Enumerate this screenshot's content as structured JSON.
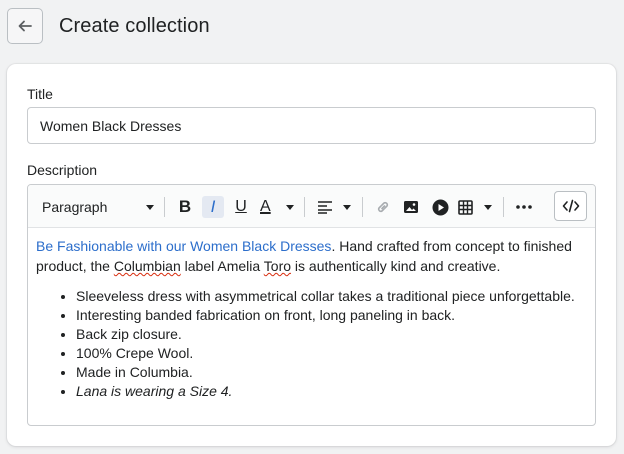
{
  "header": {
    "title": "Create collection",
    "back_icon": "arrow-left-icon"
  },
  "form": {
    "title_label": "Title",
    "title_value": "Women Black Dresses",
    "description_label": "Description"
  },
  "toolbar": {
    "paragraph_label": "Paragraph",
    "bold": "B",
    "italic": "I",
    "underline": "U",
    "text_color": "A",
    "icons": [
      "align-left-icon",
      "link-icon",
      "image-icon",
      "video-icon",
      "table-icon",
      "more-icon",
      "code-icon"
    ]
  },
  "description": {
    "link_text": "Be Fashionable with our Women Black Dresses",
    "p1": ". Hand crafted from concept to finished product, the ",
    "p2": "Columbian",
    "p3": " label Amelia ",
    "p4": "Toro",
    "p5": " is authentically kind and creative.",
    "bullets": [
      "Sleeveless dress with asymmetrical collar takes a traditional piece unforgettable.",
      "Interesting banded fabrication on front, long paneling in back.",
      "Back zip closure.",
      "100% Crepe Wool.",
      "Made in Columbia.",
      "Lana is wearing a Size 4."
    ]
  },
  "colors": {
    "accent": "#2c6ecb",
    "background": "#f1f2f3"
  }
}
